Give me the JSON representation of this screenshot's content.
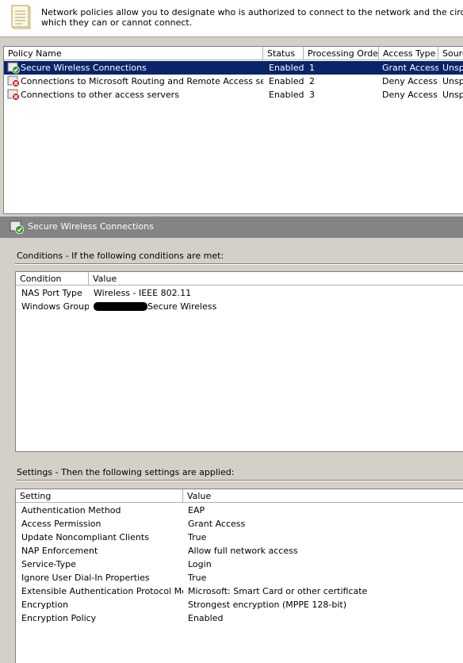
{
  "banner": {
    "text": "Network policies allow you to designate who is authorized to connect to the network and the circumstances unde\nwhich they can or cannot connect."
  },
  "policy_list": {
    "columns": [
      "Policy Name",
      "Status",
      "Processing Order",
      "Access Type",
      "Sourc"
    ],
    "rows": [
      {
        "name": "Secure Wireless Connections",
        "status": "Enabled",
        "order": "1",
        "access": "Grant Access",
        "source": "Unsp",
        "icon": "policy-grant-icon"
      },
      {
        "name": "Connections to Microsoft Routing and Remote Access server",
        "status": "Enabled",
        "order": "2",
        "access": "Deny Access",
        "source": "Unsp",
        "icon": "policy-deny-icon"
      },
      {
        "name": "Connections to other access servers",
        "status": "Enabled",
        "order": "3",
        "access": "Deny Access",
        "source": "Unsp",
        "icon": "policy-deny-icon"
      }
    ]
  },
  "detail": {
    "title": "Secure Wireless Connections",
    "icon": "policy-grant-icon"
  },
  "conditions": {
    "label": "Conditions - If the following conditions are met:",
    "columns": [
      "Condition",
      "Value"
    ],
    "rows": [
      {
        "condition": "NAS Port Type",
        "value": "Wireless - IEEE 802.11"
      },
      {
        "condition": "Windows Groups",
        "value": "Secure Wireless"
      }
    ]
  },
  "settings": {
    "label": "Settings - Then the following settings are applied:",
    "columns": [
      "Setting",
      "Value"
    ],
    "rows": [
      {
        "setting": "Authentication Method",
        "value": "EAP"
      },
      {
        "setting": "Access Permission",
        "value": "Grant Access"
      },
      {
        "setting": "Update Noncompliant Clients",
        "value": "True"
      },
      {
        "setting": "NAP Enforcement",
        "value": "Allow full network access"
      },
      {
        "setting": "Service-Type",
        "value": "Login"
      },
      {
        "setting": "Ignore User Dial-In Properties",
        "value": "True"
      },
      {
        "setting": "Extensible Authentication Protocol Method",
        "value": "Microsoft: Smart Card or other certificate"
      },
      {
        "setting": "Encryption",
        "value": "Strongest encryption (MPPE 128-bit)"
      },
      {
        "setting": "Encryption Policy",
        "value": "Enabled"
      }
    ]
  },
  "colors": {
    "selection": "#0a246a",
    "window": "#d4d0c8",
    "detail_bar": "#848484"
  }
}
